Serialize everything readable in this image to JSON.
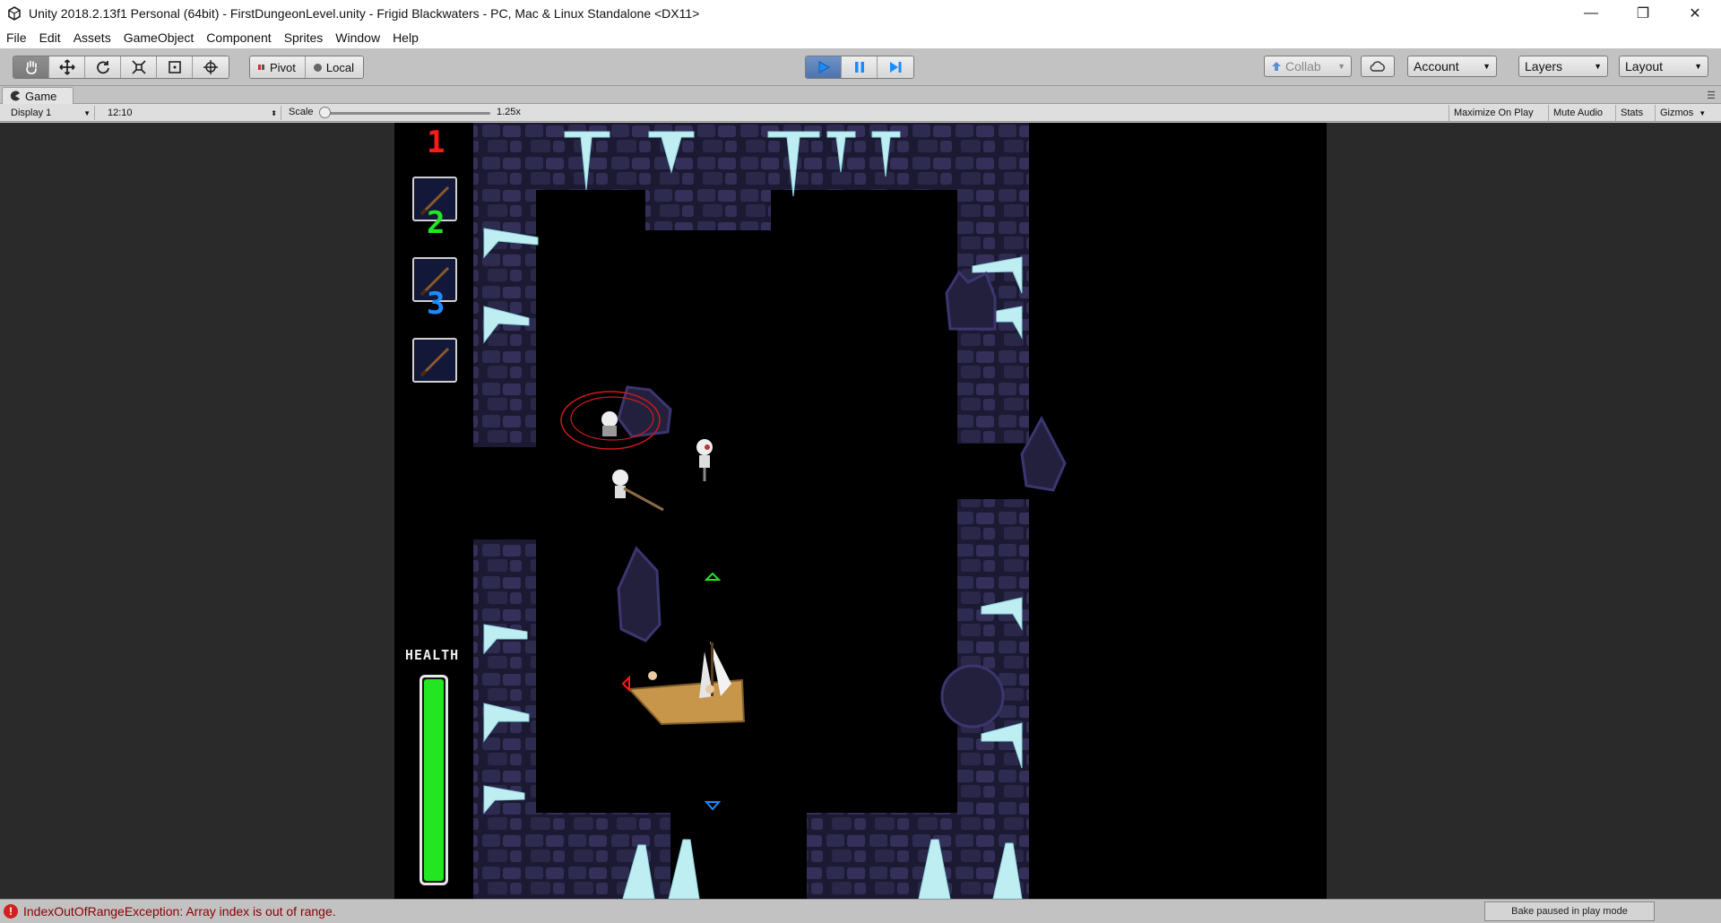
{
  "window": {
    "title": "Unity 2018.2.13f1 Personal (64bit) - FirstDungeonLevel.unity - Frigid Blackwaters - PC, Mac & Linux Standalone <DX11>",
    "minimize": "—",
    "restore": "❐",
    "close": "✕"
  },
  "menu": [
    "File",
    "Edit",
    "Assets",
    "GameObject",
    "Component",
    "Sprites",
    "Window",
    "Help"
  ],
  "toolbar": {
    "transform_tools": [
      "hand-icon",
      "move-icon",
      "rotate-icon",
      "scale-icon",
      "rect-icon",
      "transform-icon"
    ],
    "pivot_label": "Pivot",
    "local_label": "Local",
    "collab_label": "Collab",
    "account_label": "Account",
    "layers_label": "Layers",
    "layout_label": "Layout"
  },
  "game_panel": {
    "tab_label": "Game",
    "display_value": "Display 1",
    "aspect_value": "12:10",
    "scale_label": "Scale",
    "scale_value": "1.25x",
    "toggles": [
      "Maximize On Play",
      "Mute Audio",
      "Stats",
      "Gizmos"
    ]
  },
  "hud": {
    "slot_numbers": [
      "1",
      "2",
      "3"
    ],
    "slot_colors": [
      "#ff1a1a",
      "#22e622",
      "#1a8cff"
    ],
    "health_label": "HEALTH",
    "health_fraction": 1.0
  },
  "status": {
    "error_text": "IndexOutOfRangeException: Array index is out of range.",
    "bake_text": "Bake paused in play mode"
  },
  "colors": {
    "accent_play": "#4e73ad",
    "cave_wall": "#2c2a4a",
    "ice": "#bfeef2",
    "ship": "#c8964a"
  }
}
